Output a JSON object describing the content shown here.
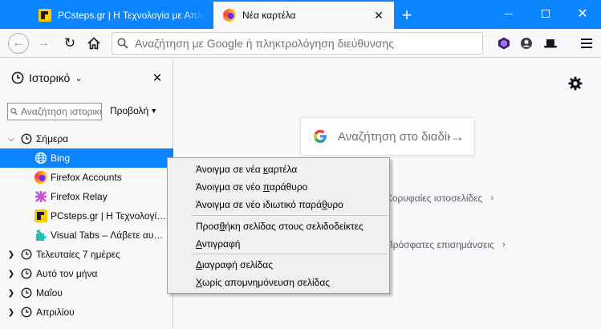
{
  "window": {
    "tabs": [
      {
        "title": "PCsteps.gr | Η Τεχνολογία με Απλά Λόγια",
        "active": false,
        "favicon": "pcsteps-icon"
      },
      {
        "title": "Νέα καρτέλα",
        "active": true,
        "favicon": "firefox-icon"
      }
    ],
    "new_tab_symbol": "+",
    "colors": {
      "titlebar": "#0a84ff",
      "accent": "#0a84ff",
      "selection": "#0a84ff"
    }
  },
  "toolbar": {
    "url_placeholder": "Αναζήτηση με Google ή πληκτρολόγηση διεύθυνσης"
  },
  "sidebar": {
    "title": "Ιστορικό",
    "search_placeholder": "Αναζήτηση ιστορικού",
    "view_label": "Προβολή",
    "groups": [
      {
        "label": "Σήμερα",
        "expanded": true,
        "items": [
          {
            "label": "Bing",
            "selected": true,
            "icon": "globe-icon"
          },
          {
            "label": "Firefox Accounts",
            "selected": false,
            "icon": "firefox-icon"
          },
          {
            "label": "Firefox Relay",
            "selected": false,
            "icon": "relay-icon"
          },
          {
            "label": "PCsteps.gr | Η Τεχνολογία με Απλά Λόγια",
            "selected": false,
            "icon": "pcsteps-icon"
          },
          {
            "label": "Visual Tabs – Λάβετε αυτή την επέκταση",
            "selected": false,
            "icon": "puzzle-icon"
          }
        ]
      },
      {
        "label": "Τελευταίες 7 ημέρες",
        "expanded": false
      },
      {
        "label": "Αυτό τον μήνα",
        "expanded": false
      },
      {
        "label": "Μαΐου",
        "expanded": false
      },
      {
        "label": "Απριλίου",
        "expanded": false
      }
    ]
  },
  "newtab": {
    "search_label": "Αναζήτηση στο διαδίκτυο",
    "section_1": "Κορυφαίες ιστοσελίδες",
    "section_2": "Πρόσφατες επισημάνσεις"
  },
  "context_menu": {
    "items": [
      {
        "label": "Άνοιγμα σε νέα καρτέλα",
        "accesskey": "κ"
      },
      {
        "label": "Άνοιγμα σε νέο παράθυρο",
        "accesskey": "π"
      },
      {
        "label": "Άνοιγμα σε νέο ιδιωτικό παράθυρο",
        "accesskey": "θ"
      },
      {
        "separator": true
      },
      {
        "label": "Προσθήκη σελίδας στους σελιδοδείκτες",
        "accesskey": "θ"
      },
      {
        "label": "Αντιγραφή",
        "accesskey": "Α"
      },
      {
        "separator": true
      },
      {
        "label": "Διαγραφή σελίδας",
        "accesskey": "Δ"
      },
      {
        "label": "Χωρίς απομνημόνευση σελίδας",
        "accesskey": "Χ"
      }
    ]
  }
}
